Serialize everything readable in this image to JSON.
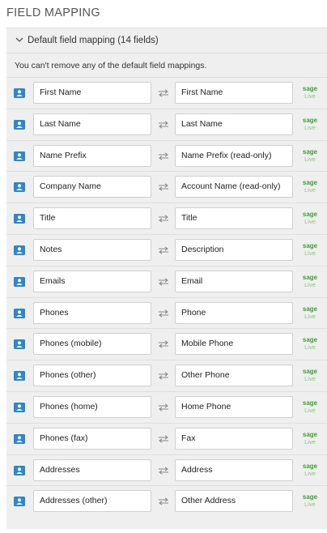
{
  "page": {
    "title": "FIELD MAPPING"
  },
  "accordion": {
    "label": "Default field mapping (14 fields)"
  },
  "notice": "You can't remove any of the default field mappings.",
  "brand": {
    "sage_top": "sage",
    "sage_bottom": "Live",
    "accent": "#3aa32c",
    "icon_blue": "#2a87d0"
  },
  "mappings": [
    {
      "source": "First Name",
      "target": "First Name"
    },
    {
      "source": "Last Name",
      "target": "Last Name"
    },
    {
      "source": "Name Prefix",
      "target": "Name Prefix (read-only)"
    },
    {
      "source": "Company Name",
      "target": "Account Name (read-only)"
    },
    {
      "source": "Title",
      "target": "Title"
    },
    {
      "source": "Notes",
      "target": "Description"
    },
    {
      "source": "Emails",
      "target": "Email"
    },
    {
      "source": "Phones",
      "target": "Phone"
    },
    {
      "source": "Phones (mobile)",
      "target": "Mobile Phone"
    },
    {
      "source": "Phones (other)",
      "target": "Other Phone"
    },
    {
      "source": "Phones (home)",
      "target": "Home Phone"
    },
    {
      "source": "Phones (fax)",
      "target": "Fax"
    },
    {
      "source": "Addresses",
      "target": "Address"
    },
    {
      "source": "Addresses (other)",
      "target": "Other Address"
    }
  ]
}
